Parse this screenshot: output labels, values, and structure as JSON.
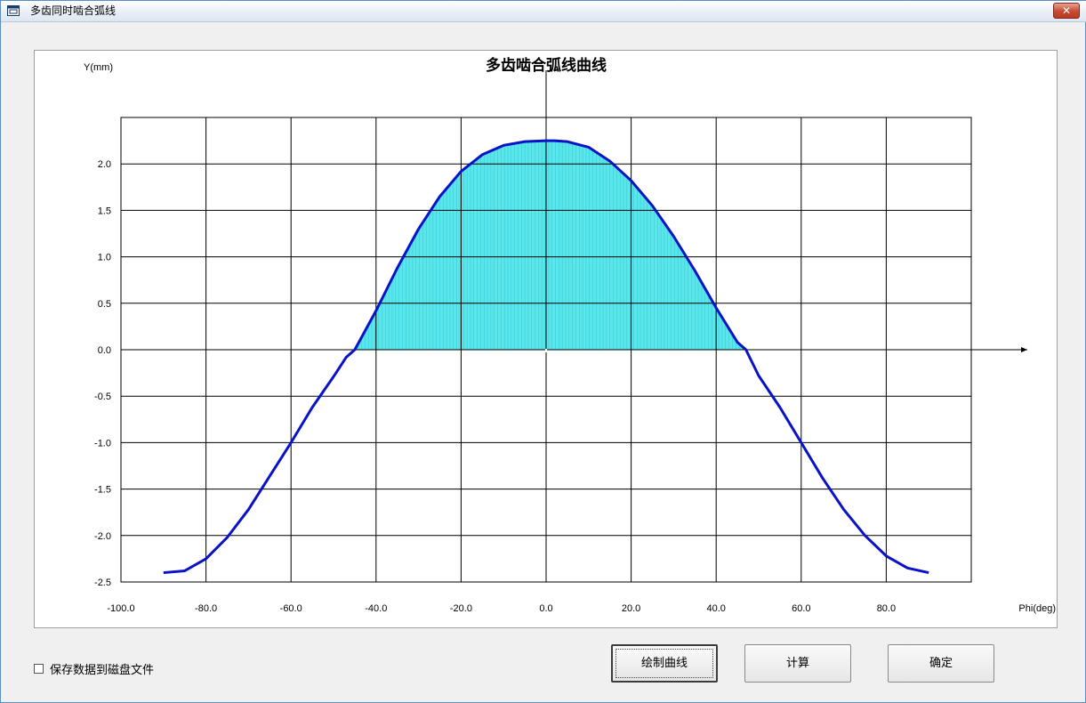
{
  "window": {
    "title": "多齿同时啮合弧线",
    "close_label": "✕"
  },
  "chart_data": {
    "type": "line",
    "title": "多齿啮合弧线曲线",
    "xlabel": "Phi(deg)",
    "ylabel": "Y(mm)",
    "xlim": [
      -100,
      100
    ],
    "ylim": [
      -2.5,
      2.5
    ],
    "x_ticks": [
      "-100.0",
      "-80.0",
      "-60.0",
      "-40.0",
      "-20.0",
      "0.0",
      "20.0",
      "40.0",
      "60.0",
      "80.0",
      "Phi(deg)"
    ],
    "y_ticks": [
      "2.0",
      "1.5",
      "1.0",
      "0.5",
      "0.0",
      "-0.5",
      "-1.0",
      "-1.5",
      "-2.0",
      "-2.5"
    ],
    "grid": true,
    "fill_positive_region": true,
    "colors": {
      "line": "#0a12c8",
      "fill": "#5ae6ea",
      "grid": "#000000"
    },
    "series": [
      {
        "x": [
          -90,
          -85,
          -80,
          -75,
          -70,
          -65,
          -60,
          -55,
          -50,
          -47,
          -45,
          -40,
          -35,
          -30,
          -25,
          -20,
          -15,
          -10,
          -5,
          0,
          2,
          5,
          10,
          15,
          20,
          25,
          30,
          35,
          40,
          45,
          47,
          50,
          55,
          60,
          65,
          70,
          75,
          80,
          85,
          90
        ],
        "y": [
          -2.4,
          -2.38,
          -2.25,
          -2.02,
          -1.72,
          -1.36,
          -1.0,
          -0.62,
          -0.29,
          -0.08,
          0.0,
          0.42,
          0.88,
          1.3,
          1.65,
          1.92,
          2.1,
          2.2,
          2.24,
          2.25,
          2.25,
          2.24,
          2.18,
          2.03,
          1.82,
          1.55,
          1.22,
          0.85,
          0.45,
          0.08,
          0.0,
          -0.28,
          -0.62,
          -1.0,
          -1.38,
          -1.72,
          -2.0,
          -2.22,
          -2.35,
          -2.4
        ]
      }
    ]
  },
  "controls": {
    "save_checkbox_label": "保存数据到磁盘文件",
    "save_checked": false,
    "draw_button": "绘制曲线",
    "calc_button": "计算",
    "ok_button": "确定"
  }
}
